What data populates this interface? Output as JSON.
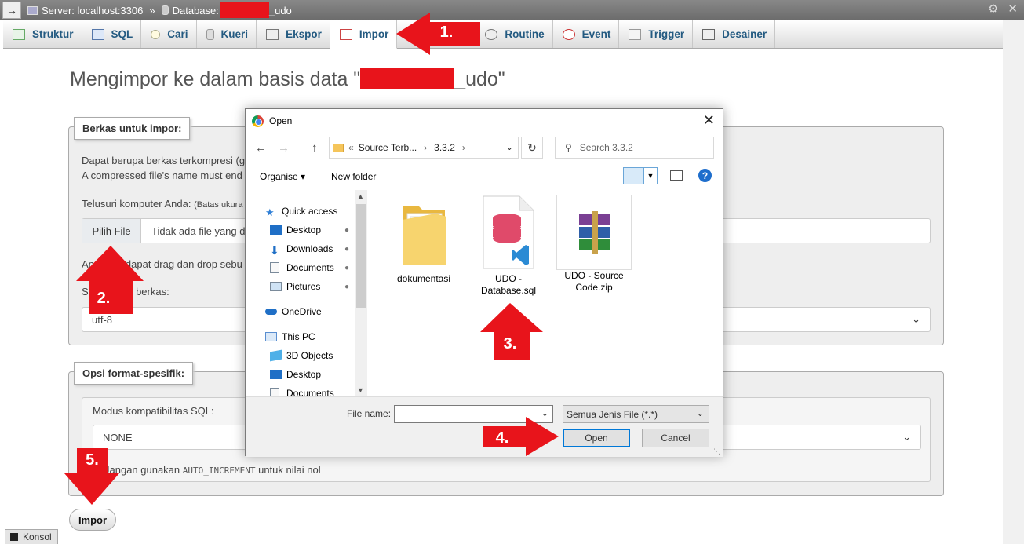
{
  "server_bar": {
    "server_label": "Server: localhost:3306",
    "separator": "»",
    "database_label": "Database:",
    "database_suffix": "_udo",
    "toggle_glyph": "→",
    "gear_glyph": "⚙",
    "close_glyph": "✕"
  },
  "tabs": [
    {
      "label": "Struktur",
      "icon": "structure-icon"
    },
    {
      "label": "SQL",
      "icon": "sql-icon"
    },
    {
      "label": "Cari",
      "icon": "search-icon"
    },
    {
      "label": "Kueri",
      "icon": "query-icon"
    },
    {
      "label": "Ekspor",
      "icon": "export-icon"
    },
    {
      "label": "Impor",
      "icon": "import-icon",
      "active": true
    },
    {
      "label": "Routine",
      "icon": "routine-icon"
    },
    {
      "label": "Event",
      "icon": "event-icon"
    },
    {
      "label": "Trigger",
      "icon": "trigger-icon"
    },
    {
      "label": "Desainer",
      "icon": "designer-icon"
    }
  ],
  "page": {
    "title_prefix": "Mengimpor ke dalam basis data \"",
    "title_suffix": "_udo\""
  },
  "import_file": {
    "legend": "Berkas untuk impor:",
    "line1": "Dapat berupa berkas terkompresi (g",
    "line2": "A compressed file's name must end",
    "browse_label": "Telusuri komputer Anda:",
    "browse_note": "(Batas ukura",
    "choose_button": "Pilih File",
    "no_file": "Tidak ada file yang d",
    "drag_text_a": "An",
    "drag_text_b": "dapat drag dan drop sebu",
    "charset_label_a": "Se",
    "charset_label_b": "er berkas:",
    "charset_value": "utf-8"
  },
  "format_options": {
    "legend": "Opsi format-spesifik:",
    "sql_compat_label": "Modus kompatibilitas SQL:",
    "sql_compat_value": "NONE",
    "auto_inc_text_a": "Jangan gunakan ",
    "auto_inc_code": "AUTO_INCREMENT",
    "auto_inc_text_b": " untuk nilai nol"
  },
  "impor_button": "Impor",
  "konsol": "Konsol",
  "dialog": {
    "title": "Open",
    "close_glyph": "✕",
    "back_glyph": "←",
    "forward_glyph": "→",
    "up_glyph": "↑",
    "breadcrumb": [
      "«",
      "Source Terb...",
      "›",
      "3.3.2",
      "›"
    ],
    "refresh_glyph": "↻",
    "search_placeholder": "Search 3.3.2",
    "organise": "Organise ▾",
    "new_folder": "New folder",
    "help_glyph": "?",
    "nav_items": [
      {
        "label": "Quick access",
        "icon": "star-icon",
        "color": "#2f7fd6"
      },
      {
        "label": "Desktop",
        "icon": "desktop-icon",
        "color": "#1f6fc6",
        "pinned": true
      },
      {
        "label": "Downloads",
        "icon": "download-icon",
        "color": "#1f6fc6",
        "pinned": true
      },
      {
        "label": "Documents",
        "icon": "document-icon",
        "color": "#7a8a9a",
        "pinned": true
      },
      {
        "label": "Pictures",
        "icon": "pictures-icon",
        "color": "#7a8a9a",
        "pinned": true
      },
      {
        "label": "OneDrive",
        "icon": "cloud-icon",
        "color": "#1f6fc6"
      },
      {
        "label": "This PC",
        "icon": "pc-icon",
        "color": "#5a8ed0"
      },
      {
        "label": "3D Objects",
        "icon": "cube-icon",
        "color": "#4fb0e8"
      },
      {
        "label": "Desktop",
        "icon": "desktop-icon",
        "color": "#1f6fc6"
      },
      {
        "label": "Documents",
        "icon": "document-icon",
        "color": "#7a8a9a"
      }
    ],
    "pin_glyph": "📌",
    "files": [
      {
        "name": "dokumentasi",
        "icon": "folder-icon"
      },
      {
        "name": "UDO - Database.sql",
        "name_l1": "UDO -",
        "name_l2": "Database.sql",
        "icon": "sql-file-icon"
      },
      {
        "name": "UDO - Source Code.zip",
        "name_l1": "UDO - Source",
        "name_l2": "Code.zip",
        "icon": "winrar-archive-icon"
      }
    ],
    "file_name_label": "File name:",
    "file_name_value": "",
    "file_type": "Semua Jenis File (*.*)",
    "open_button": "Open",
    "cancel_button": "Cancel"
  },
  "annotations": [
    "1.",
    "2.",
    "3.",
    "4.",
    "5."
  ],
  "colors": {
    "annotation_red": "#e8141b",
    "link_blue": "#235a81",
    "accent_blue": "#0078d7"
  }
}
